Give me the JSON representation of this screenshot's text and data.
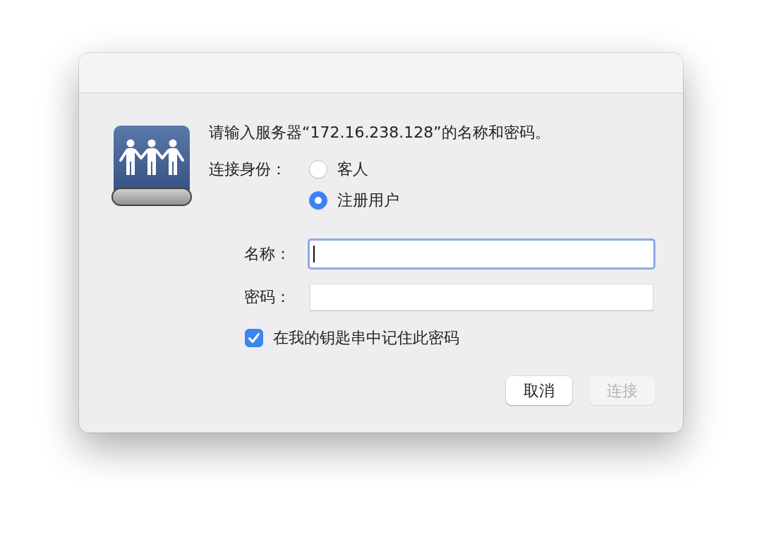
{
  "message": "请输入服务器“172.16.238.128”的名称和密码。",
  "connect_as": {
    "label": "连接身份：",
    "options": [
      {
        "label": "客人",
        "selected": false
      },
      {
        "label": "注册用户",
        "selected": true
      }
    ]
  },
  "fields": [
    {
      "label": "名称：",
      "focused": true
    },
    {
      "label": "密码：",
      "focused": false
    }
  ],
  "remember": {
    "label": "在我的钥匙串中记住此密码",
    "checked": true
  },
  "buttons": [
    {
      "label": "取消",
      "disabled": false
    },
    {
      "label": "连接",
      "disabled": true
    }
  ]
}
